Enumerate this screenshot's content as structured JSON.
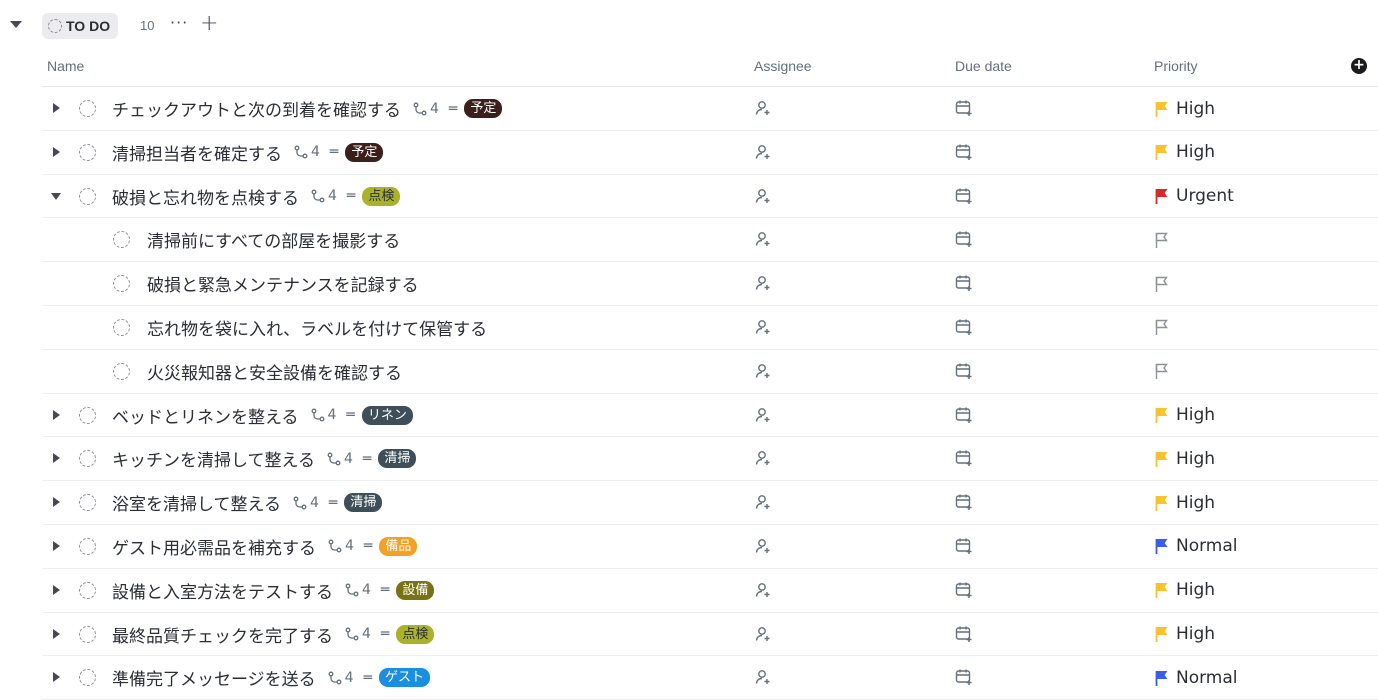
{
  "group": {
    "status_label": "TO DO",
    "count": "10",
    "more_label": "···",
    "add_label": "+"
  },
  "columns": {
    "name": "Name",
    "assignee": "Assignee",
    "due_date": "Due date",
    "priority": "Priority"
  },
  "colors": {
    "high": "#f9c22e",
    "urgent": "#d62b2b",
    "normal": "#3b5ee6",
    "empty_flag": "#8c9097"
  },
  "tasks": [
    {
      "name": "チェックアウトと次の到着を確認する",
      "subtasks": "4",
      "tag": "予定",
      "tag_color": "#3b1f1b",
      "priority": "High",
      "priority_level": "high",
      "level": 0,
      "expanded": false
    },
    {
      "name": "清掃担当者を確定する",
      "subtasks": "4",
      "tag": "予定",
      "tag_color": "#3b1f1b",
      "priority": "High",
      "priority_level": "high",
      "level": 0,
      "expanded": false
    },
    {
      "name": "破損と忘れ物を点検する",
      "subtasks": "4",
      "tag": "点検",
      "tag_color": "#aab12a",
      "tag_text_color": "#2a2e34",
      "priority": "Urgent",
      "priority_level": "urgent",
      "level": 0,
      "expanded": true
    },
    {
      "name": "清掃前にすべての部屋を撮影する",
      "subtasks": "",
      "tag": "",
      "priority": "",
      "priority_level": "none",
      "level": 1,
      "expanded": false
    },
    {
      "name": "破損と緊急メンテナンスを記録する",
      "subtasks": "",
      "tag": "",
      "priority": "",
      "priority_level": "none",
      "level": 1,
      "expanded": false
    },
    {
      "name": "忘れ物を袋に入れ、ラベルを付けて保管する",
      "subtasks": "",
      "tag": "",
      "priority": "",
      "priority_level": "none",
      "level": 1,
      "expanded": false
    },
    {
      "name": "火災報知器と安全設備を確認する",
      "subtasks": "",
      "tag": "",
      "priority": "",
      "priority_level": "none",
      "level": 1,
      "expanded": false
    },
    {
      "name": "ベッドとリネンを整える",
      "subtasks": "4",
      "tag": "リネン",
      "tag_color": "#3f4f5a",
      "priority": "High",
      "priority_level": "high",
      "level": 0,
      "expanded": false
    },
    {
      "name": "キッチンを清掃して整える",
      "subtasks": "4",
      "tag": "清掃",
      "tag_color": "#3f4f5a",
      "priority": "High",
      "priority_level": "high",
      "level": 0,
      "expanded": false
    },
    {
      "name": "浴室を清掃して整える",
      "subtasks": "4",
      "tag": "清掃",
      "tag_color": "#3f4f5a",
      "priority": "High",
      "priority_level": "high",
      "level": 0,
      "expanded": false
    },
    {
      "name": "ゲスト用必需品を補充する",
      "subtasks": "4",
      "tag": "備品",
      "tag_color": "#f4a024",
      "priority": "Normal",
      "priority_level": "normal",
      "level": 0,
      "expanded": false
    },
    {
      "name": "設備と入室方法をテストする",
      "subtasks": "4",
      "tag": "設備",
      "tag_color": "#7a7114",
      "priority": "High",
      "priority_level": "high",
      "level": 0,
      "expanded": false
    },
    {
      "name": "最終品質チェックを完了する",
      "subtasks": "4",
      "tag": "点検",
      "tag_color": "#aab12a",
      "tag_text_color": "#2a2e34",
      "priority": "High",
      "priority_level": "high",
      "level": 0,
      "expanded": false
    },
    {
      "name": "準備完了メッセージを送る",
      "subtasks": "4",
      "tag": "ゲスト",
      "tag_color": "#1a8fe0",
      "priority": "Normal",
      "priority_level": "normal",
      "level": 0,
      "expanded": false
    }
  ],
  "icons": {
    "subtask": "subtask-icon",
    "description": "description-icon",
    "assignee": "add-assignee-icon",
    "due": "add-due-date-icon",
    "priority": "flag-icon"
  }
}
